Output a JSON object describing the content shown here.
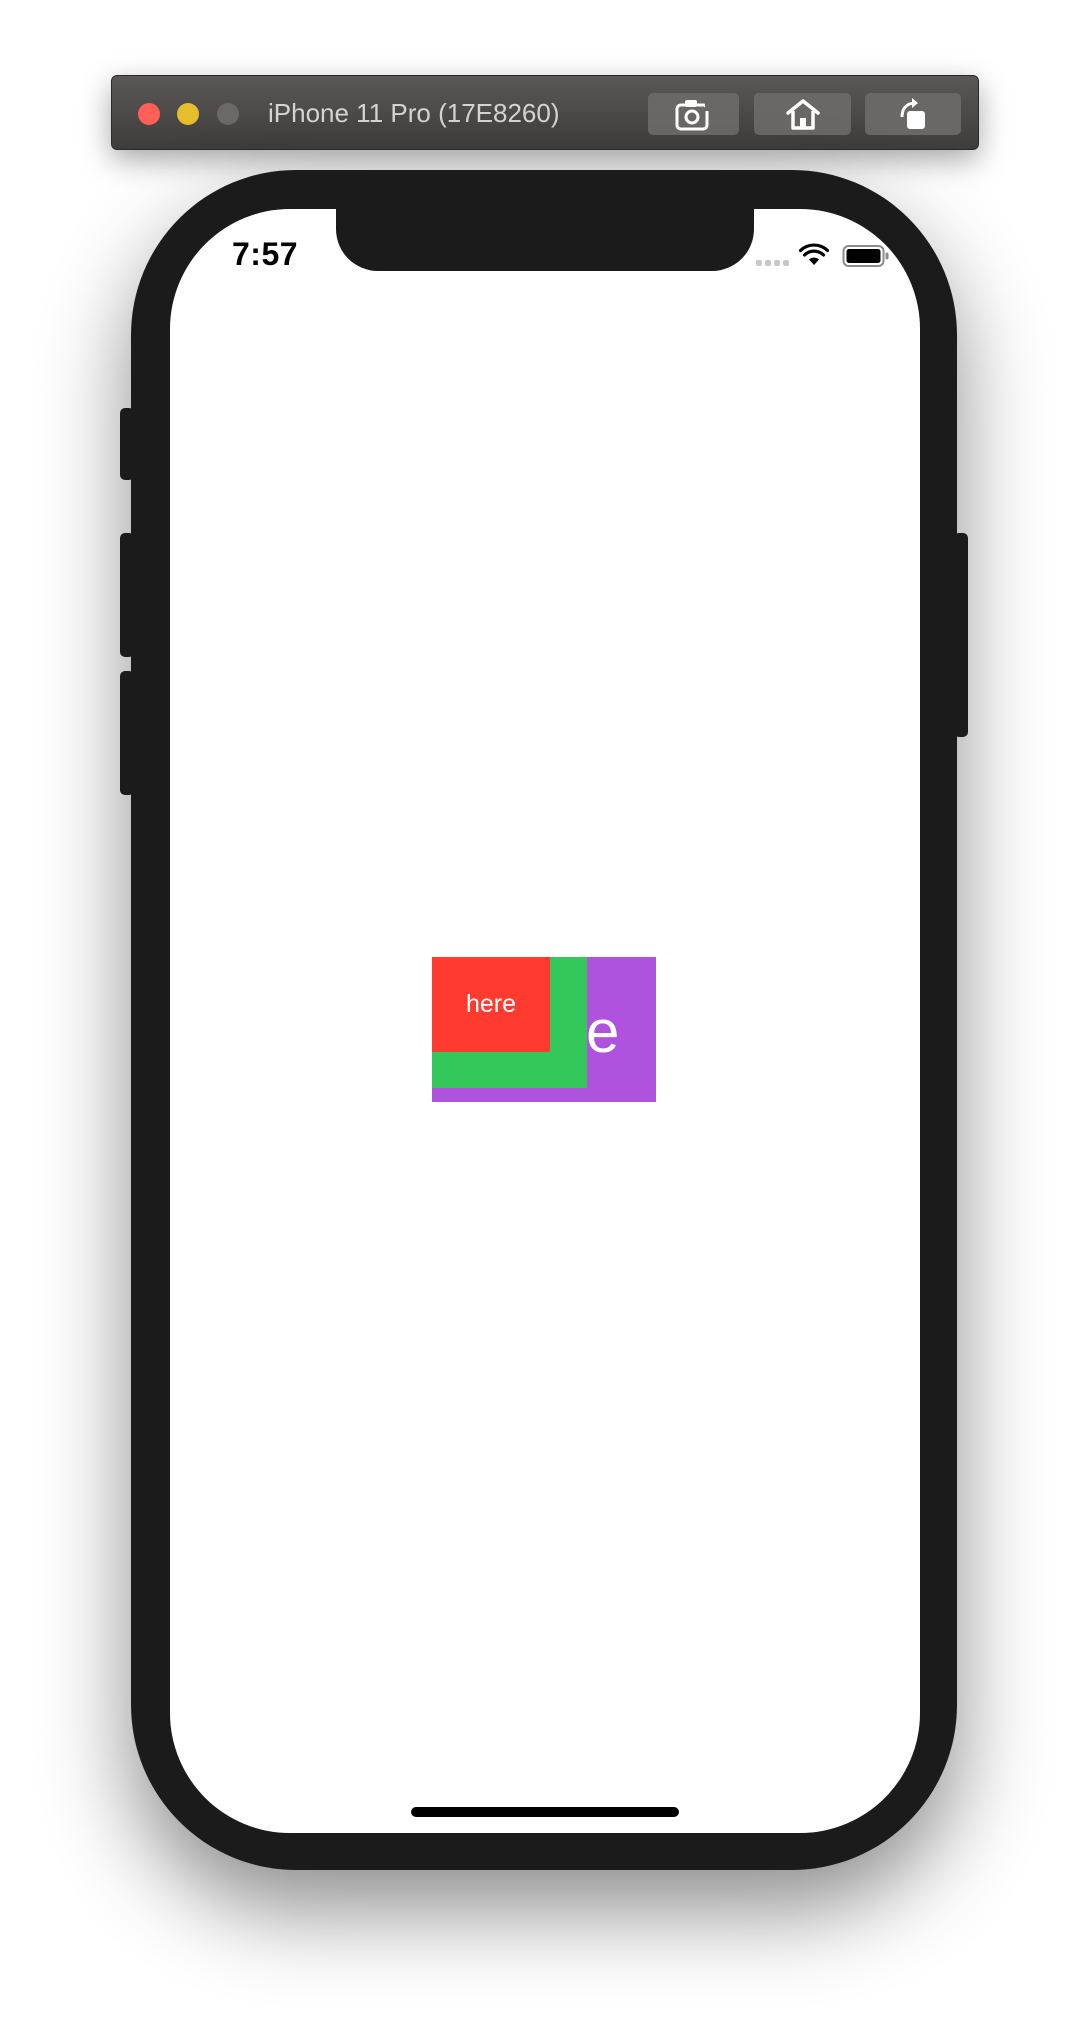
{
  "simulator": {
    "title": "iPhone 11 Pro (17E8260)",
    "buttons": {
      "screenshot_icon": "camera-icon",
      "home_icon": "home-icon",
      "rotate_icon": "rotate-icon"
    }
  },
  "status_bar": {
    "time": "7:57",
    "signal_icon": "cellular-signal-icon",
    "wifi_icon": "wifi-icon",
    "battery_icon": "battery-icon"
  },
  "content": {
    "red_label": "here",
    "purple_label": "e",
    "colors": {
      "purple": "#af52de",
      "green": "#34c759",
      "red": "#ff3b30"
    }
  }
}
